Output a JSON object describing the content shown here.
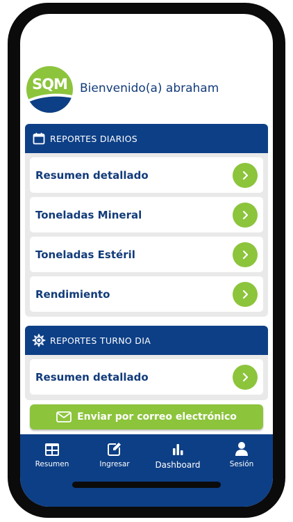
{
  "header": {
    "logo_text": "SQM",
    "welcome": "Bienvenido(a) abraham"
  },
  "daily_reports": {
    "title": "REPORTES DIARIOS",
    "icon": "calendar-icon",
    "items": [
      {
        "label": "Resumen detallado"
      },
      {
        "label": "Toneladas Mineral"
      },
      {
        "label": "Toneladas Estéril"
      },
      {
        "label": "Rendimiento"
      }
    ]
  },
  "day_shift_reports": {
    "title": "REPORTES TURNO DIA",
    "icon": "sun-icon",
    "items": [
      {
        "label": "Resumen detallado"
      }
    ]
  },
  "email_button": {
    "label": "Enviar por correo electrónico",
    "icon": "envelope-icon"
  },
  "bottom_nav": {
    "items": [
      {
        "label": "Resumen",
        "icon": "table-icon"
      },
      {
        "label": "Ingresar",
        "icon": "edit-icon"
      },
      {
        "label": "Dashboard",
        "icon": "bar-chart-icon"
      },
      {
        "label": "Sesión",
        "icon": "user-icon"
      }
    ]
  },
  "colors": {
    "primary_blue": "#0d3f86",
    "accent_green": "#8cc43c",
    "text_blue": "#123b7a",
    "card_background": "#e9e9e9"
  }
}
